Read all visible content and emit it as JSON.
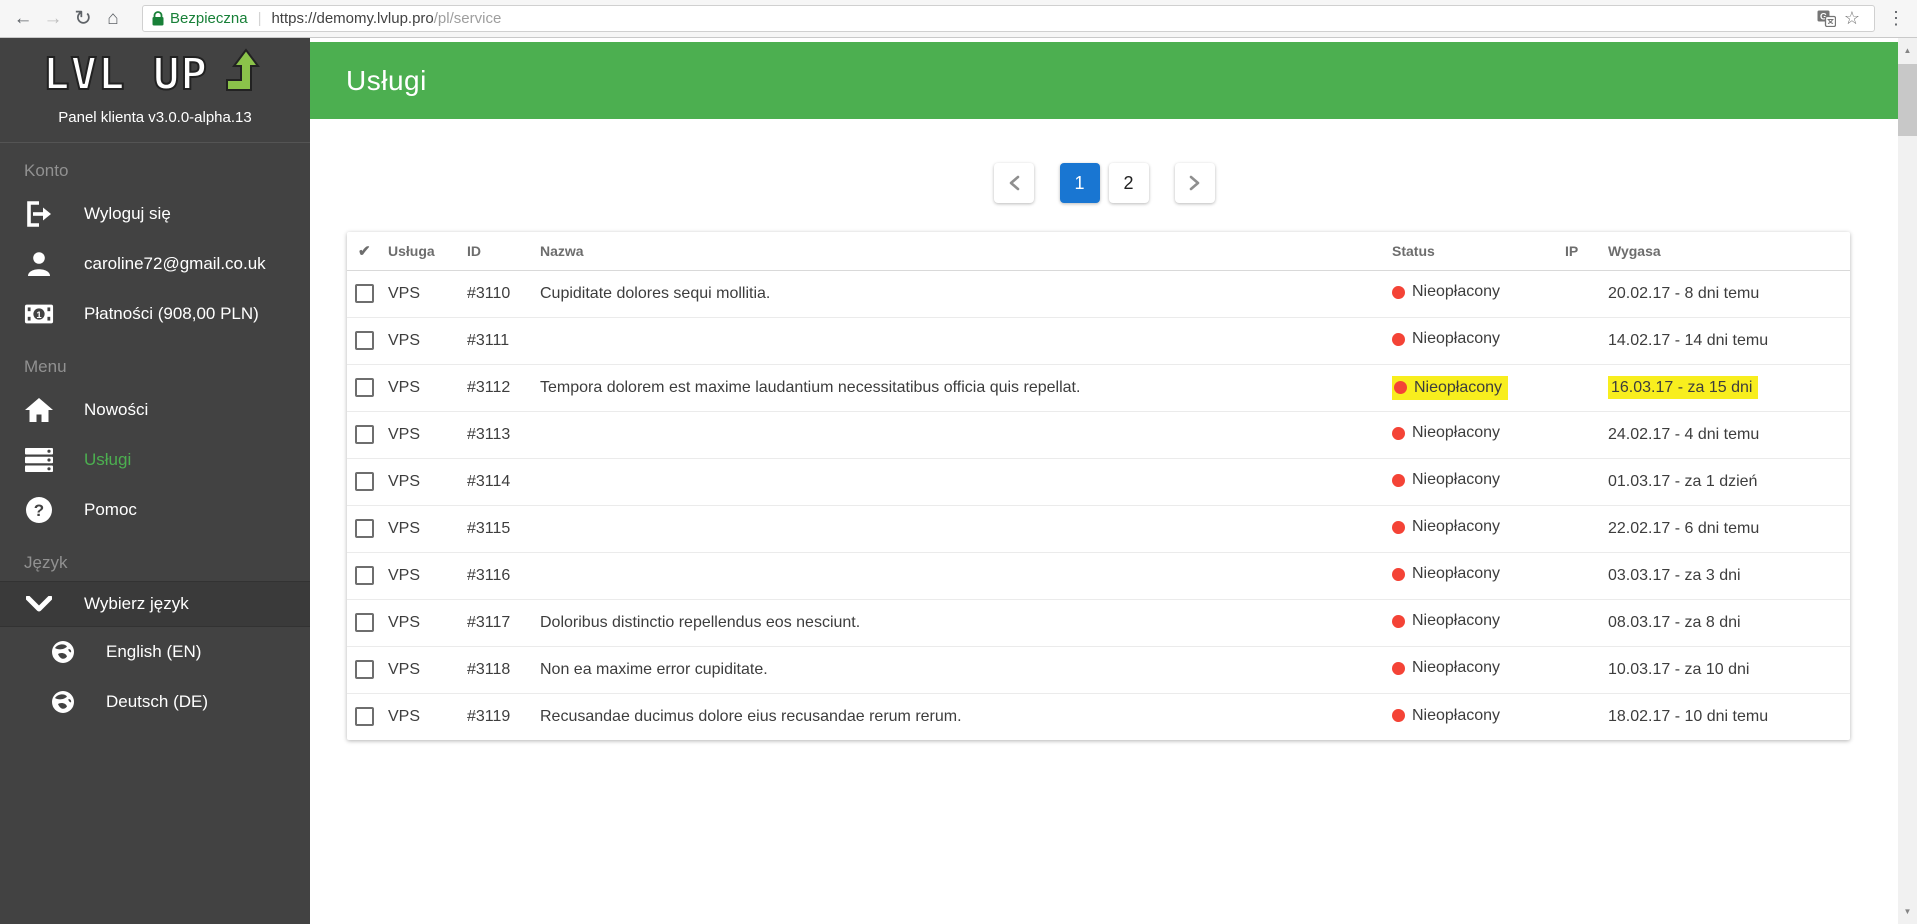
{
  "colors": {
    "accent_green": "#4caf50",
    "secure_green": "#188038",
    "pagination_active_blue": "#1976d2",
    "status_red": "#f44336",
    "highlight_yellow": "#f8ee1e",
    "sidebar_bg": "#424242"
  },
  "glyphs": {
    "back": "←",
    "forward": "→",
    "reload": "↻",
    "home": "⌂",
    "star": "☆",
    "menu": "⋮",
    "check": "✔",
    "up": "▲",
    "down": "▼",
    "url_separator": "|"
  },
  "browser": {
    "secure_label": "Bezpieczna",
    "url_host": "https://demomy.lvlup.pro",
    "url_path": "/pl/service"
  },
  "sidebar": {
    "logo_text": "LVL UP",
    "tagline": "Panel klienta v3.0.0-alpha.13",
    "sections": [
      {
        "label": "Konto",
        "items": [
          {
            "label": "Wyloguj się",
            "icon": "logout-icon"
          },
          {
            "label": "caroline72@gmail.co.uk",
            "icon": "user-icon"
          },
          {
            "label": "Płatności (908,00 PLN)",
            "icon": "payments-icon"
          }
        ]
      },
      {
        "label": "Menu",
        "items": [
          {
            "label": "Nowości",
            "icon": "home-icon"
          },
          {
            "label": "Usługi",
            "icon": "services-icon",
            "active": true
          },
          {
            "label": "Pomoc",
            "icon": "help-icon"
          }
        ]
      },
      {
        "label": "Język",
        "items": [
          {
            "label": "Wybierz język",
            "icon": "chevron-down-icon"
          },
          {
            "label": "English (EN)",
            "icon": "globe-icon",
            "sub": true
          },
          {
            "label": "Deutsch (DE)",
            "icon": "globe-icon",
            "sub": true
          }
        ]
      }
    ]
  },
  "header": {
    "title": "Usługi"
  },
  "pagination": {
    "pages": [
      {
        "label": "1",
        "active": true
      },
      {
        "label": "2",
        "active": false
      }
    ]
  },
  "table": {
    "headers": {
      "service": "Usługa",
      "id": "ID",
      "name": "Nazwa",
      "status": "Status",
      "ip": "IP",
      "expires": "Wygasa"
    },
    "rows": [
      {
        "type": "VPS",
        "id": "#3110",
        "name": "Cupiditate dolores sequi mollitia.",
        "status": "Nieopłacony",
        "ip": "",
        "expires": "20.02.17 - 8 dni temu",
        "highlight": false
      },
      {
        "type": "VPS",
        "id": "#3111",
        "name": "",
        "status": "Nieopłacony",
        "ip": "",
        "expires": "14.02.17 - 14 dni temu",
        "highlight": false
      },
      {
        "type": "VPS",
        "id": "#3112",
        "name": "Tempora dolorem est maxime laudantium necessitatibus officia quis repellat.",
        "status": "Nieopłacony",
        "ip": "",
        "expires": "16.03.17 - za 15 dni",
        "highlight": true
      },
      {
        "type": "VPS",
        "id": "#3113",
        "name": "",
        "status": "Nieopłacony",
        "ip": "",
        "expires": "24.02.17 - 4 dni temu",
        "highlight": false
      },
      {
        "type": "VPS",
        "id": "#3114",
        "name": "",
        "status": "Nieopłacony",
        "ip": "",
        "expires": "01.03.17 - za 1 dzień",
        "highlight": false
      },
      {
        "type": "VPS",
        "id": "#3115",
        "name": "",
        "status": "Nieopłacony",
        "ip": "",
        "expires": "22.02.17 - 6 dni temu",
        "highlight": false
      },
      {
        "type": "VPS",
        "id": "#3116",
        "name": "",
        "status": "Nieopłacony",
        "ip": "",
        "expires": "03.03.17 - za 3 dni",
        "highlight": false
      },
      {
        "type": "VPS",
        "id": "#3117",
        "name": "Doloribus distinctio repellendus eos nesciunt.",
        "status": "Nieopłacony",
        "ip": "",
        "expires": "08.03.17 - za 8 dni",
        "highlight": false
      },
      {
        "type": "VPS",
        "id": "#3118",
        "name": "Non ea maxime error cupiditate.",
        "status": "Nieopłacony",
        "ip": "",
        "expires": "10.03.17 - za 10 dni",
        "highlight": false
      },
      {
        "type": "VPS",
        "id": "#3119",
        "name": "Recusandae ducimus dolore eius recusandae rerum rerum.",
        "status": "Nieopłacony",
        "ip": "",
        "expires": "18.02.17 - 10 dni temu",
        "highlight": false
      }
    ]
  }
}
